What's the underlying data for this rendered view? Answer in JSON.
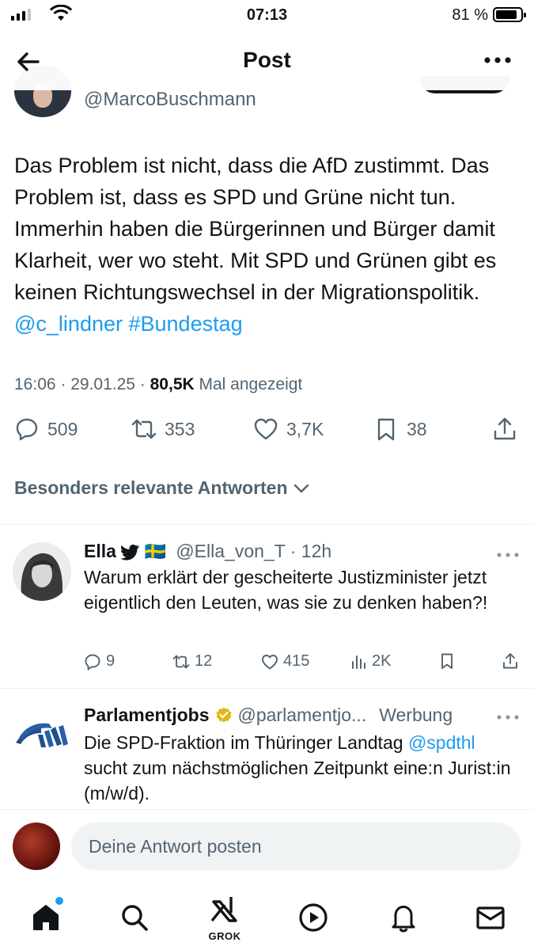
{
  "status_bar": {
    "time": "07:13",
    "battery_percent": "81 %",
    "battery_level": 0.81
  },
  "header": {
    "title": "Post",
    "back_icon": "arrow-left-icon",
    "more_icon": "more-horizontal-icon"
  },
  "post": {
    "handle": "@MarcoBuschmann",
    "text_main": "Das Problem ist nicht, dass die AfD zustimmt. Das Problem ist, dass es SPD und Grüne nicht tun. Immerhin haben die Bürgerinnen und Bürger damit Klarheit, wer wo steht. Mit SPD und Grünen gibt es keinen Richtungswechsel in der Migrationspolitik. ",
    "mention": "@c_lindner",
    "hashtag": "#Bundestag",
    "timestamp": "16:06 · 29.01.25 · ",
    "views_count": "80,5K",
    "views_label": " Mal angezeigt",
    "replies": "509",
    "reposts": "353",
    "likes": "3,7K",
    "bookmarks": "38"
  },
  "replies_filter": {
    "label": "Besonders relevante Antworten"
  },
  "replies": [
    {
      "name": "Ella",
      "flag": "🇸🇪",
      "handle": "@Ella_von_T",
      "time": "· 12h",
      "text": "Warum erklärt der gescheiterte Justizminister jetzt eigentlich den Leuten, was sie zu denken haben?!",
      "replies": "9",
      "reposts": "12",
      "likes": "415",
      "views": "2K"
    },
    {
      "name": "Parlamentjobs",
      "handle": "@parlamentjo...",
      "ad_label": "Werbung",
      "text_1": "Die SPD-Fraktion im Thüringer Landtag ",
      "mention": "@spdthl",
      "text_2": " sucht zum nächstmöglichen Zeitpunkt eine:n Jurist:in (m/w/d)."
    }
  ],
  "composer": {
    "placeholder": "Deine Antwort posten"
  },
  "tabbar": {
    "grok_label": "GROK",
    "items": [
      "home-icon",
      "search-icon",
      "grok-icon",
      "play-icon",
      "bell-icon",
      "mail-icon"
    ]
  },
  "colors": {
    "link": "#1d9bf0",
    "secondary_text": "#536471",
    "primary_text": "#0f1419",
    "verified_gold": "#e2b719"
  }
}
